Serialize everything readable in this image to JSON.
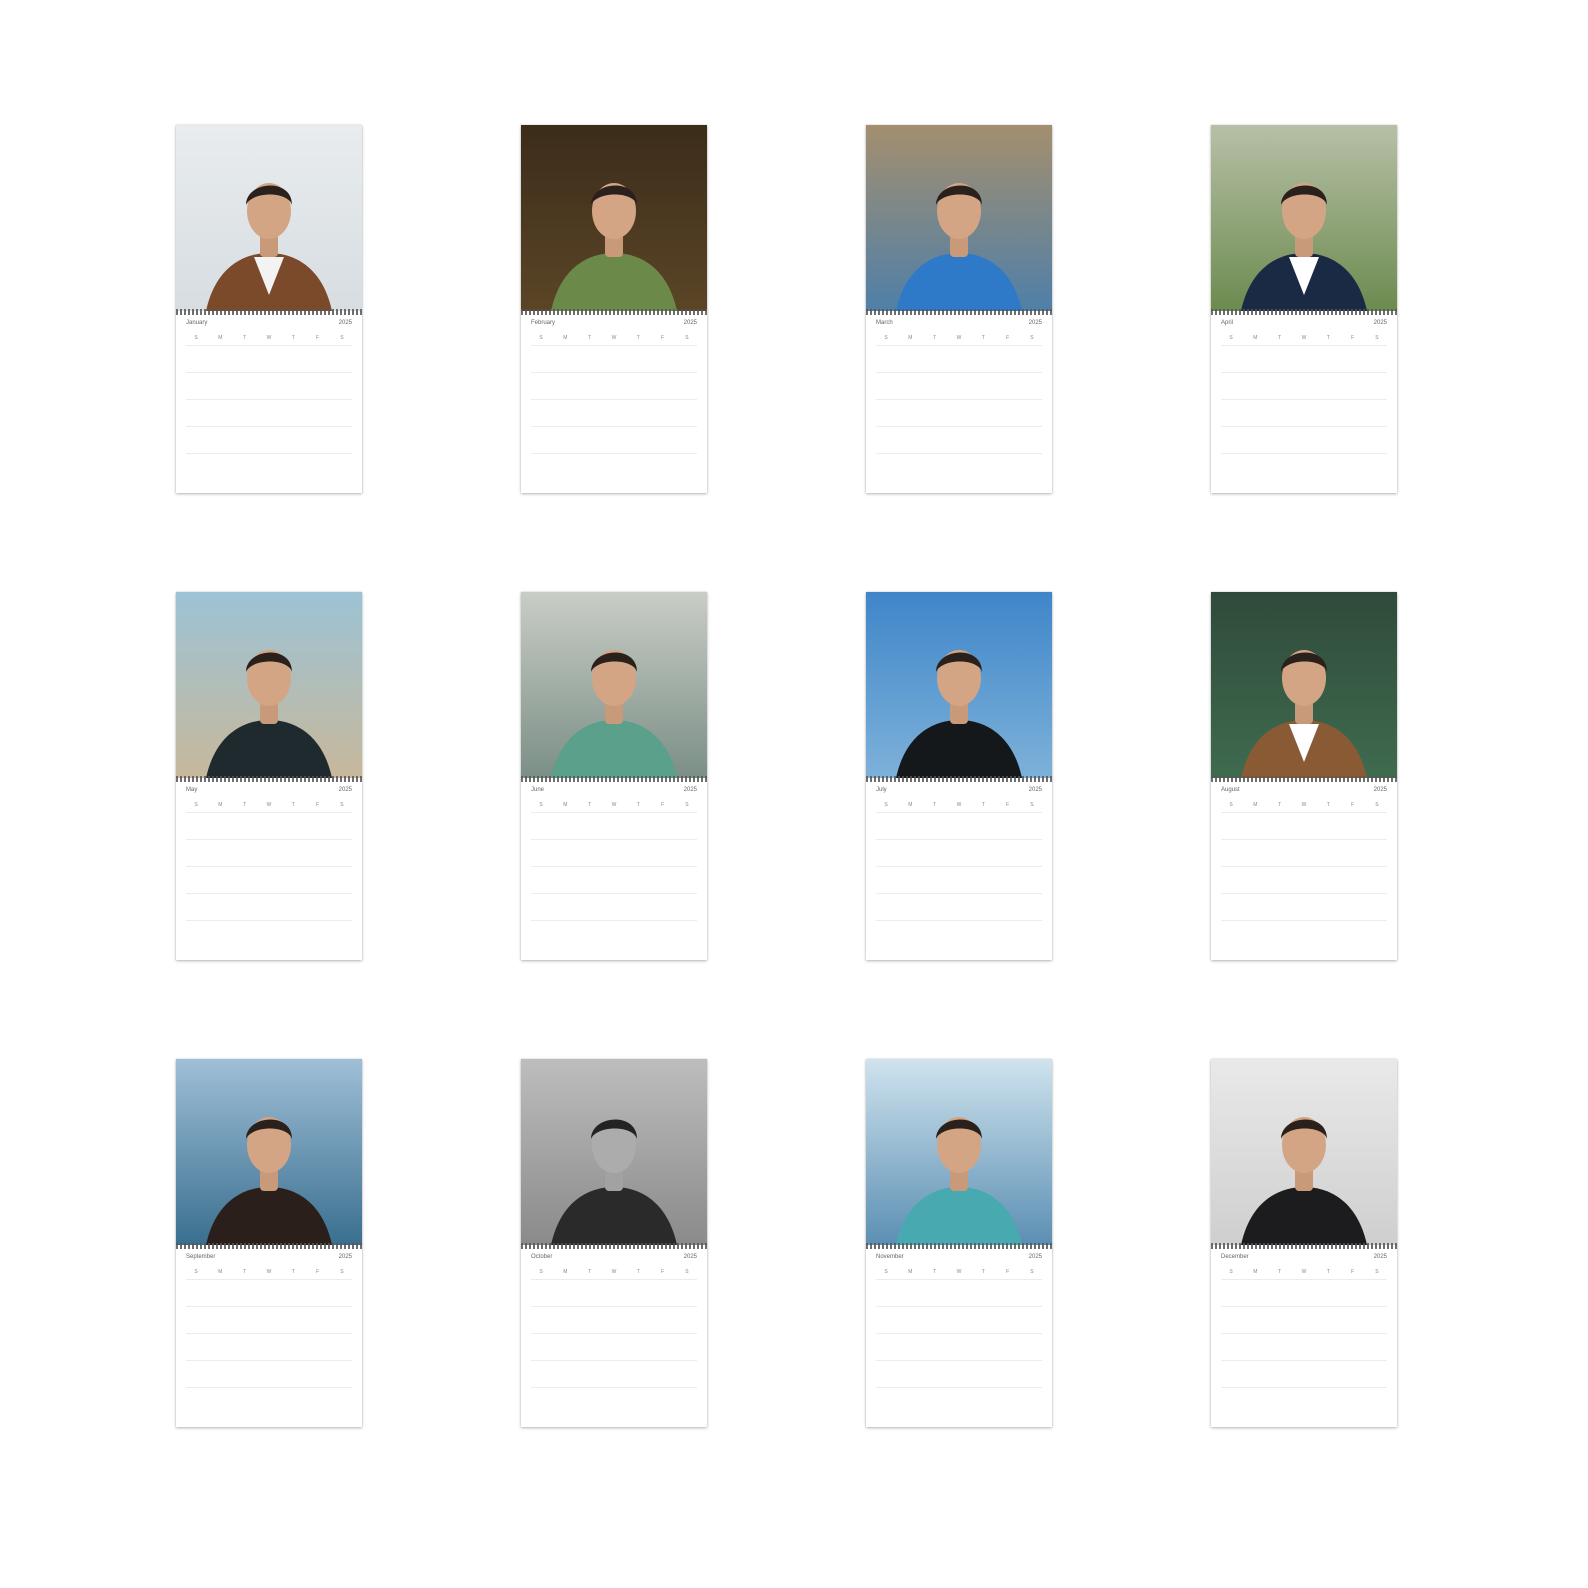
{
  "year": "2025",
  "months": [
    {
      "label": "January",
      "scene": "studio-light",
      "shirt": "#f3f3f3",
      "jacket": "#7a4a2a",
      "bg1": "#e8ecef",
      "bg2": "#d7dde1"
    },
    {
      "label": "February",
      "scene": "jungle",
      "shirt": "#6b8a4a",
      "jacket": "#6b8a4a",
      "bg1": "#3b2c1a",
      "bg2": "#5b4526"
    },
    {
      "label": "March",
      "scene": "beach",
      "shirt": "#2f79c9",
      "jacket": "#2f79c9",
      "bg1": "#a48f6e",
      "bg2": "#4f7fa8"
    },
    {
      "label": "April",
      "scene": "garden",
      "shirt": "#ffffff",
      "jacket": "#1b2a44",
      "bg1": "#b7c0a7",
      "bg2": "#6c8b4f"
    },
    {
      "label": "May",
      "scene": "shore",
      "shirt": "#1f2a2e",
      "jacket": "#1f2a2e",
      "bg1": "#9cc3d6",
      "bg2": "#c7b89b"
    },
    {
      "label": "June",
      "scene": "rocks",
      "shirt": "#5aa08b",
      "jacket": "#5aa08b",
      "bg1": "#c9cdc6",
      "bg2": "#7b8f86"
    },
    {
      "label": "July",
      "scene": "island",
      "shirt": "#15181b",
      "jacket": "#15181b",
      "bg1": "#3f86c9",
      "bg2": "#7db1d9"
    },
    {
      "label": "August",
      "scene": "idol",
      "shirt": "#ffffff",
      "jacket": "#8a5a34",
      "bg1": "#2f4a3a",
      "bg2": "#3f6b4f"
    },
    {
      "label": "September",
      "scene": "cap-sea",
      "shirt": "#2a1f1a",
      "jacket": "#2a1f1a",
      "bg1": "#9fbfd7",
      "bg2": "#3a6f8f"
    },
    {
      "label": "October",
      "scene": "monochrome",
      "shirt": "#2a2a2a",
      "jacket": "#2a2a2a",
      "bg1": "#bdbdbd",
      "bg2": "#8a8a8a"
    },
    {
      "label": "November",
      "scene": "sky-beach",
      "shirt": "#48a9b0",
      "jacket": "#48a9b0",
      "bg1": "#cfe3ee",
      "bg2": "#5b8fb3"
    },
    {
      "label": "December",
      "scene": "studio-grey",
      "shirt": "#1c1c1f",
      "jacket": "#1c1c1f",
      "bg1": "#e9e9e9",
      "bg2": "#cfcfcf"
    }
  ],
  "weekdays": [
    "S",
    "M",
    "T",
    "W",
    "T",
    "F",
    "S"
  ]
}
